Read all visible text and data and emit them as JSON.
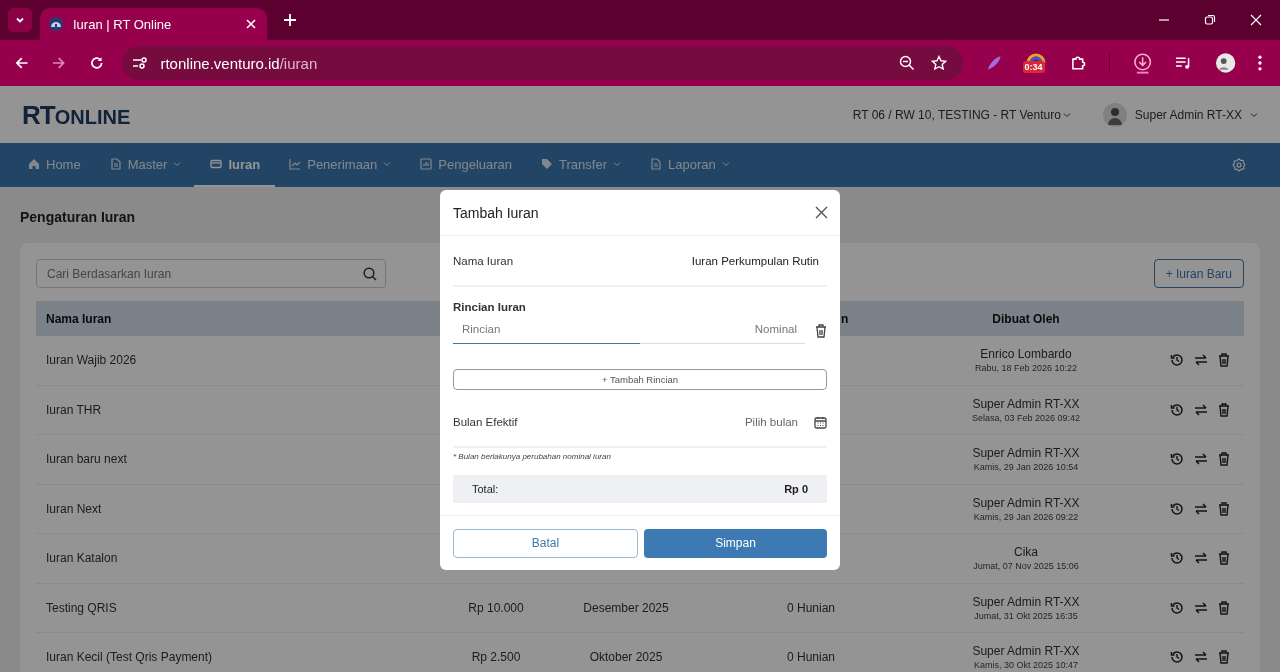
{
  "browser": {
    "tab_title": "Iuran | RT Online",
    "url_host": "rtonline.venturo.id",
    "url_path": "/iuran",
    "extension_badge": "0:34",
    "forward_disabled": true
  },
  "header": {
    "logo_primary": "RT",
    "logo_secondary": "ONLINE",
    "community": "RT 06 / RW 10, TESTING - RT Venturo",
    "user": "Super Admin RT-XX"
  },
  "nav": {
    "items": [
      {
        "label": "Home",
        "dropdown": false,
        "selected": false
      },
      {
        "label": "Master",
        "dropdown": true,
        "selected": false
      },
      {
        "label": "Iuran",
        "dropdown": false,
        "selected": true
      },
      {
        "label": "Penerimaan",
        "dropdown": true,
        "selected": false
      },
      {
        "label": "Pengeluaran",
        "dropdown": false,
        "selected": false
      },
      {
        "label": "Transfer",
        "dropdown": true,
        "selected": false
      },
      {
        "label": "Laporan",
        "dropdown": true,
        "selected": false
      }
    ]
  },
  "page": {
    "title": "Pengaturan Iuran",
    "search": {
      "placeholder": "Cari Berdasarkan Iuran"
    },
    "new_button": "+ Iuran Baru"
  },
  "table": {
    "headers": {
      "name": "Nama Iuran",
      "column_4": "n",
      "creator": "Dibuat Oleh"
    },
    "rows": [
      {
        "name": "Iuran Wajib 2026",
        "creator": "Enrico Lombardo",
        "created_at": "Rabu, 18 Feb 2026 10:22"
      },
      {
        "name": "Iuran THR",
        "creator": "Super Admin RT-XX",
        "created_at": "Selasa, 03 Feb 2026 09:42"
      },
      {
        "name": "Iuran baru next",
        "creator": "Super Admin RT-XX",
        "created_at": "Kamis, 29 Jan 2026 10:54"
      },
      {
        "name": "Iuran Next",
        "creator": "Super Admin RT-XX",
        "created_at": "Kamis, 29 Jan 2026 09:22"
      },
      {
        "name": "Iuran Katalon",
        "creator": "Cika",
        "created_at": "Jumat, 07 Nov 2025 15:06"
      },
      {
        "name": "Testing QRIS",
        "nominal": "Rp 10.000",
        "month": "Desember 2025",
        "residents": "0 Hunian",
        "creator": "Super Admin RT-XX",
        "created_at": "Jumat, 31 Okt 2025 16:35"
      },
      {
        "name": "Iuran Kecil (Test Qris Payment)",
        "nominal": "Rp 2.500",
        "month": "Oktober 2025",
        "residents": "0 Hunian",
        "creator": "Super Admin RT-XX",
        "created_at": "Kamis, 30 Okt 2025 10:47"
      }
    ]
  },
  "modal": {
    "title": "Tambah Iuran",
    "name_field": {
      "label": "Nama Iuran",
      "value": "Iuran Perkumpulan Rutin"
    },
    "details": {
      "label": "Rincian Iuran",
      "rows": [
        {
          "detail_placeholder": "Rincian",
          "nominal_placeholder": "Nominal",
          "focused": true
        }
      ],
      "add_button": "+ Tambah Rincian"
    },
    "month_field": {
      "label": "Bulan Efektif",
      "placeholder": "Pilih bulan",
      "note": "* Bulan berlakunya perubahan nominal iuran"
    },
    "total": {
      "label": "Total:",
      "value": "Rp 0"
    },
    "buttons": [
      {
        "label": "Batal",
        "kind": "secondary"
      },
      {
        "label": "Simpan",
        "kind": "primary"
      }
    ]
  }
}
